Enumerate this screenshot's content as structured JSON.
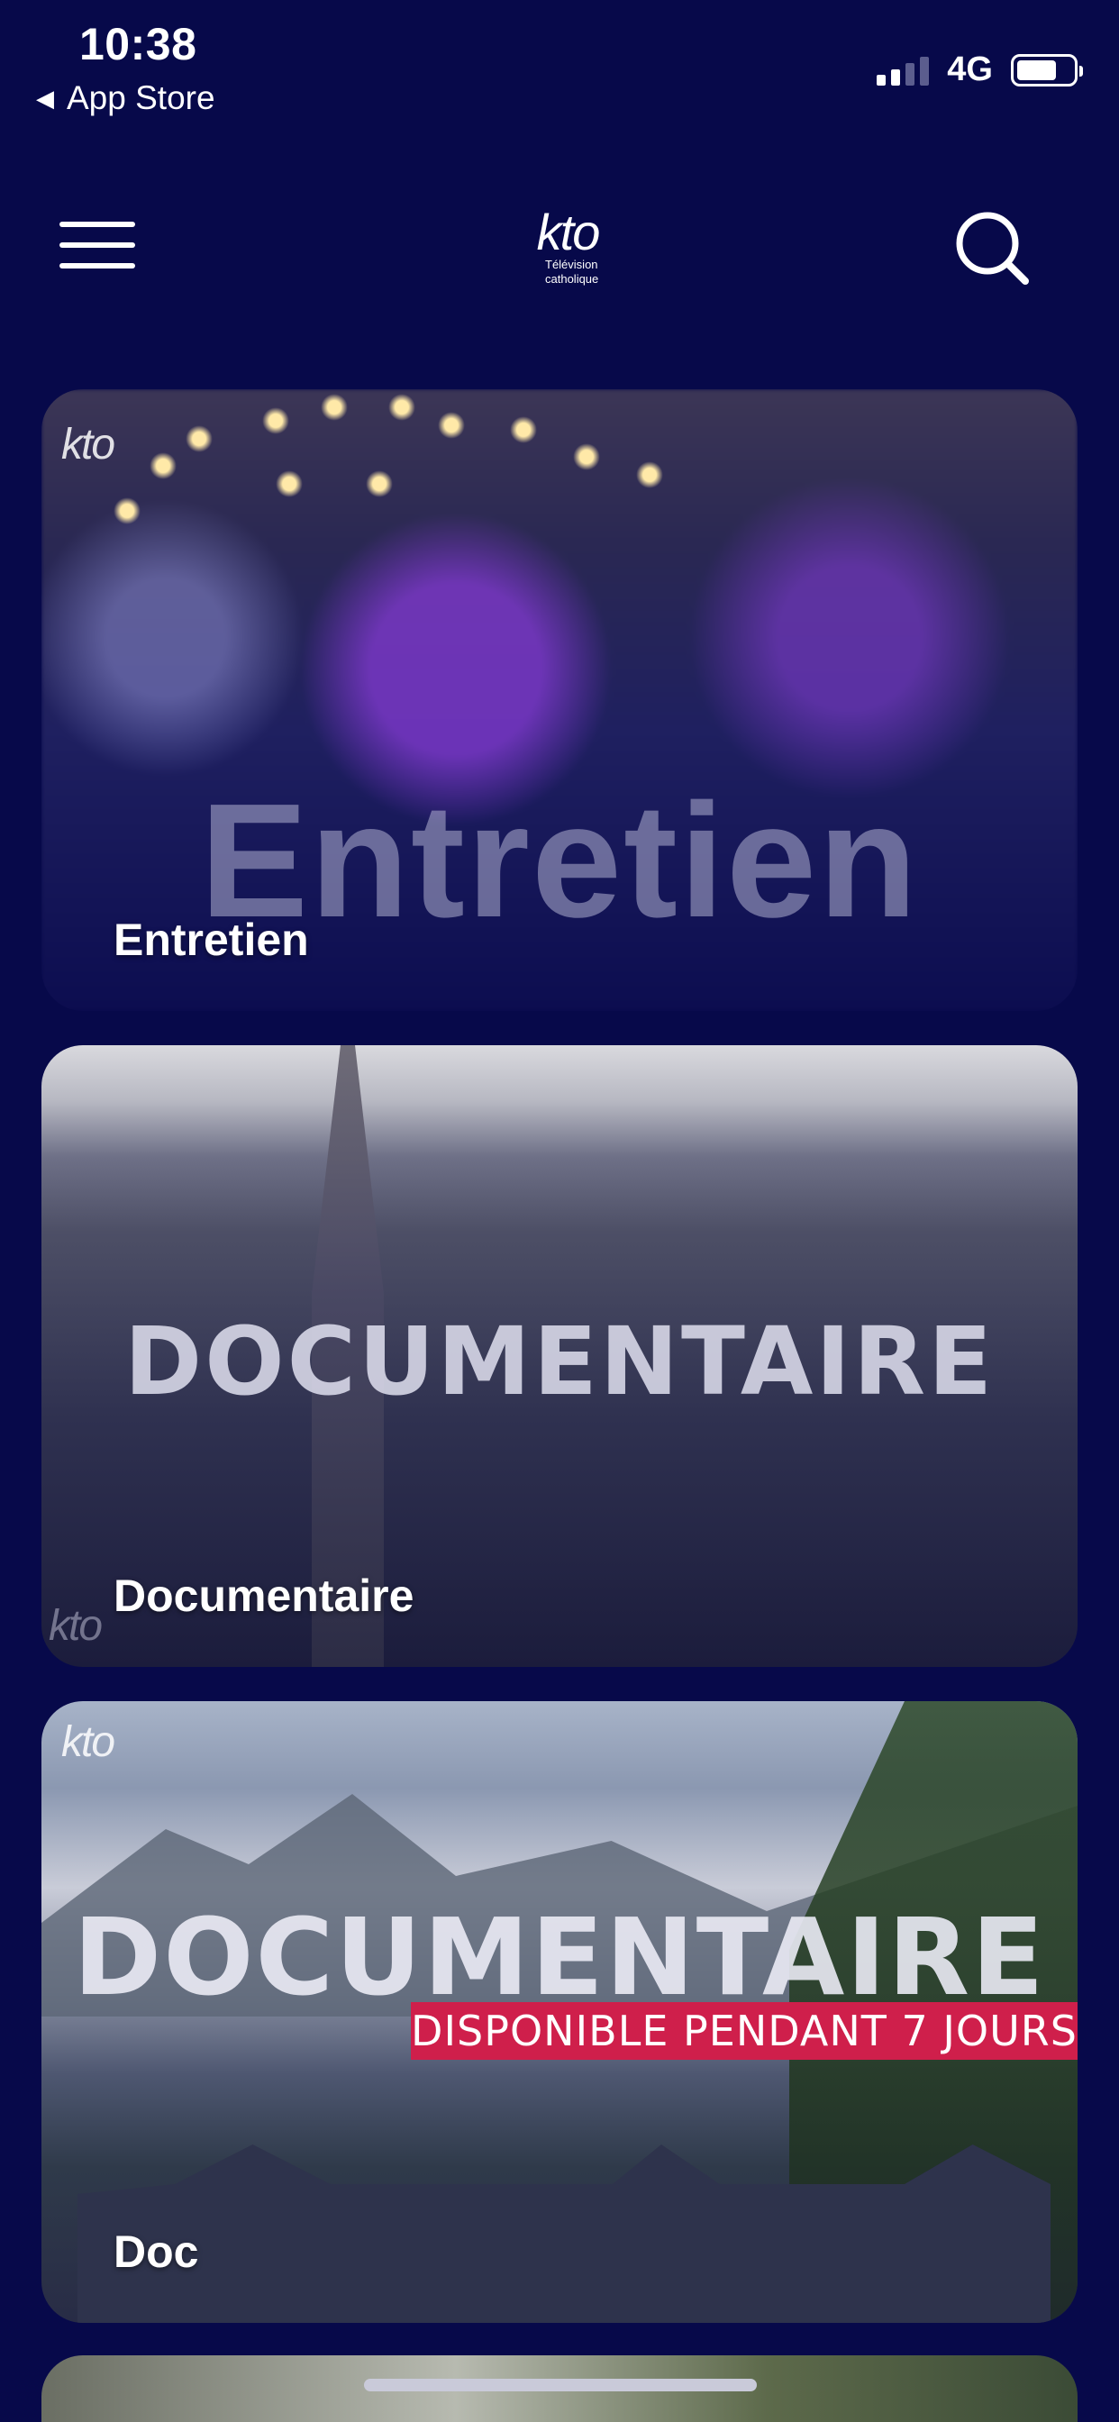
{
  "status_bar": {
    "time": "10:38",
    "back_label": "App Store",
    "network": "4G",
    "signal_bars_active": 2,
    "battery_level": 0.72
  },
  "header": {
    "logo_text": "kto",
    "logo_subtitle": [
      "Télévision",
      "catholique"
    ],
    "menu_icon": "hamburger-icon",
    "search_icon": "search-icon"
  },
  "cards": [
    {
      "label": "Entretien",
      "watermark": "kto",
      "image_text": "Entretien"
    },
    {
      "label": "Documentaire",
      "watermark": "kto",
      "image_text": "DOCUMENTAIRE"
    },
    {
      "label": "Doc",
      "watermark": "kto",
      "image_text": "DOCUMENTAIRE",
      "banner": "DISPONIBLE PENDANT 7 JOURS"
    }
  ],
  "colors": {
    "background": "#07094a",
    "banner": "#cf1f4b",
    "text": "#ffffff"
  }
}
